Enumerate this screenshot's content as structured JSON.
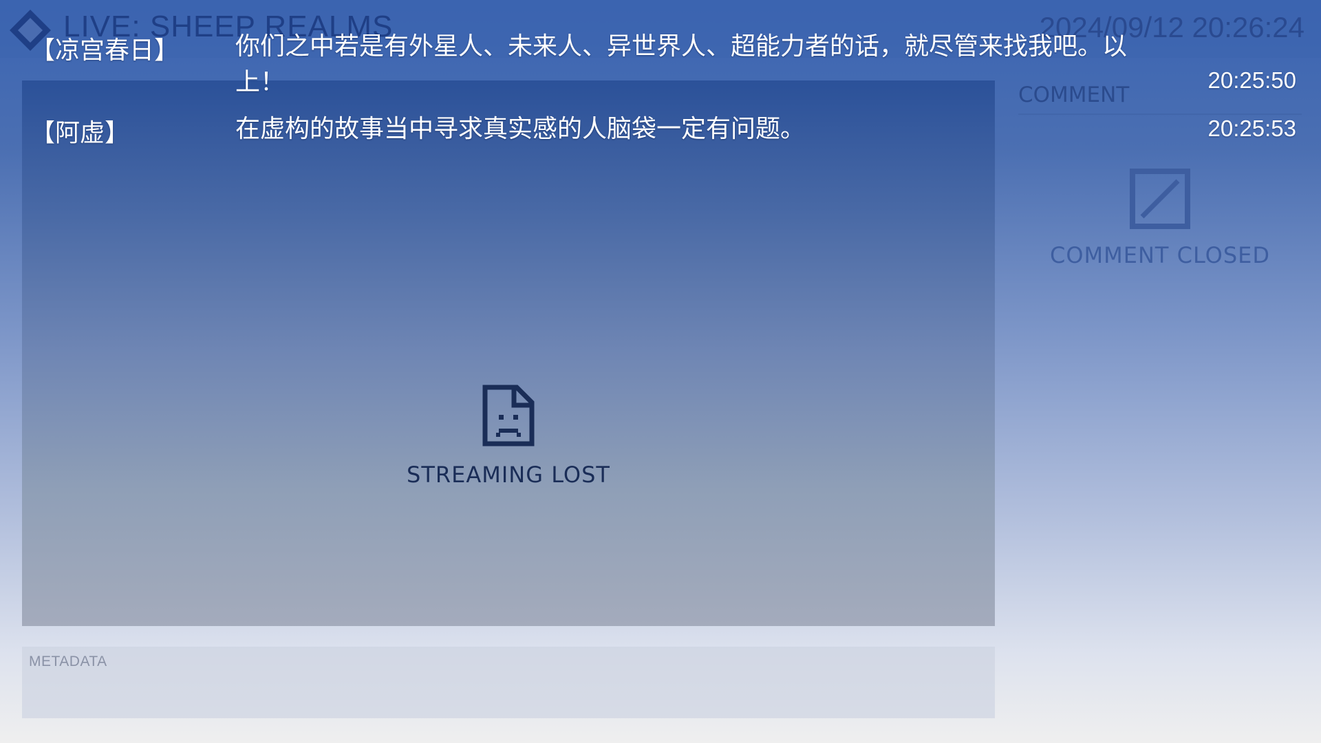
{
  "header": {
    "title": "LIVE: SHEEP REALMS",
    "datetime": "2024/09/12 20:26:24",
    "logo_icon": "diamond-logo-icon"
  },
  "stream": {
    "status_label": "STREAMING LOST",
    "status_icon": "sad-document-icon"
  },
  "metadata": {
    "label": "METADATA"
  },
  "comments": {
    "header": "COMMENT",
    "status_label": "COMMENT CLOSED",
    "status_icon": "comment-closed-icon"
  },
  "transcript": [
    {
      "speaker": "【凉宫春日】",
      "text": "你们之中若是有外星人、未来人、异世界人、超能力者的话，就尽管来找我吧。以上！",
      "time": "20:25:50"
    },
    {
      "speaker": "【阿虚】",
      "text": "在虚构的故事当中寻求真实感的人脑袋一定有问题。",
      "time": "20:25:53"
    }
  ],
  "colors": {
    "accent_dark": "#1f3f86",
    "panel_top": "#2b5199",
    "panel_bottom": "#a4abbc",
    "text_light": "#ffffff"
  }
}
